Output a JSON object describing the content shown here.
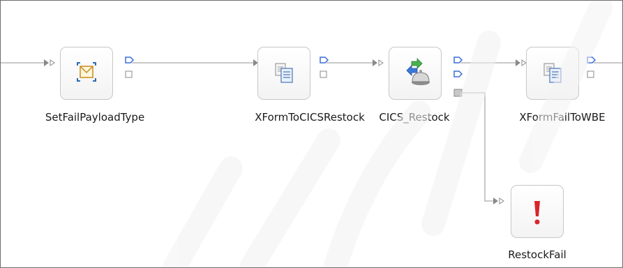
{
  "flow": {
    "nodes": [
      {
        "id": "set-fail-payload",
        "label": "SetFailPayloadType",
        "icon": "envelope-transform-icon"
      },
      {
        "id": "xform-to-cics",
        "label": "XFormToCICSRestock",
        "icon": "document-mapping-icon"
      },
      {
        "id": "cics-restock",
        "label": "CICS_Restock",
        "icon": "cics-service-invoke-icon"
      },
      {
        "id": "xform-fail-wbe",
        "label": "XFormFailToWBE",
        "icon": "document-mapping-icon"
      },
      {
        "id": "restock-fail",
        "label": "RestockFail",
        "icon": "error-exclamation-icon"
      }
    ]
  },
  "colors": {
    "wire": "#a9a9a9",
    "terminal_out": "#3b6fd6",
    "terminal_in": "#8a8a8a",
    "error": "#d9242b"
  }
}
